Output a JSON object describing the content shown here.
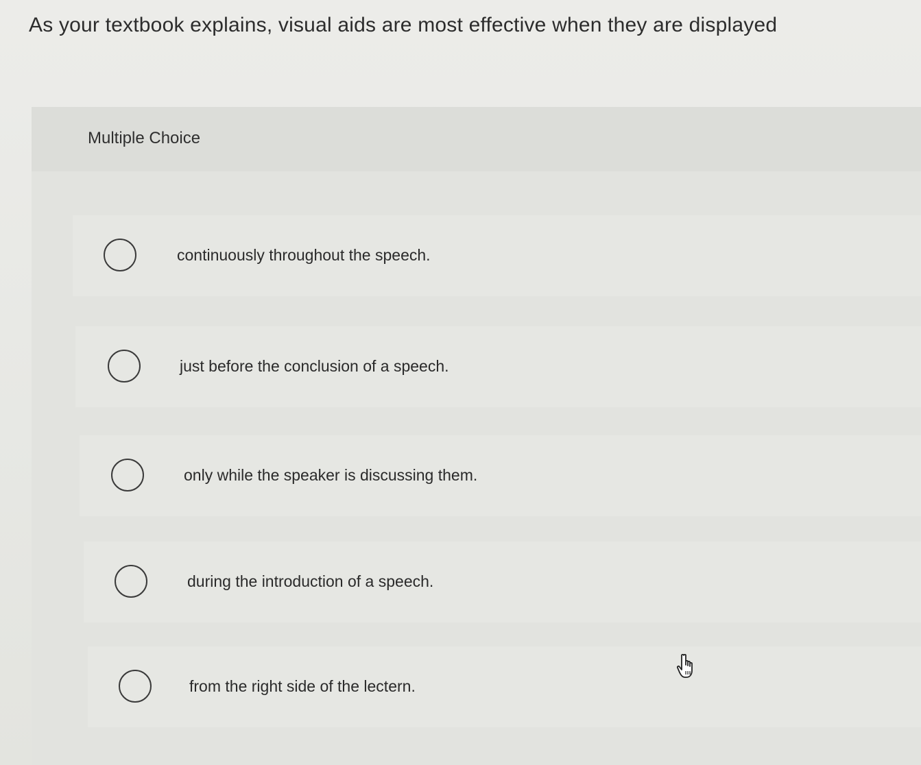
{
  "question": {
    "text": "As your textbook explains, visual aids are most effective when they are displayed"
  },
  "multiple_choice": {
    "label": "Multiple Choice",
    "options": [
      {
        "label": "continuously throughout the speech.",
        "selected": false
      },
      {
        "label": "just before the conclusion of a speech.",
        "selected": false
      },
      {
        "label": "only while the speaker is discussing them.",
        "selected": false
      },
      {
        "label": "during the introduction of a speech.",
        "selected": false
      },
      {
        "label": "from the right side of the lectern.",
        "selected": false
      }
    ]
  },
  "cursor": {
    "icon": "hand-pointer-icon"
  }
}
